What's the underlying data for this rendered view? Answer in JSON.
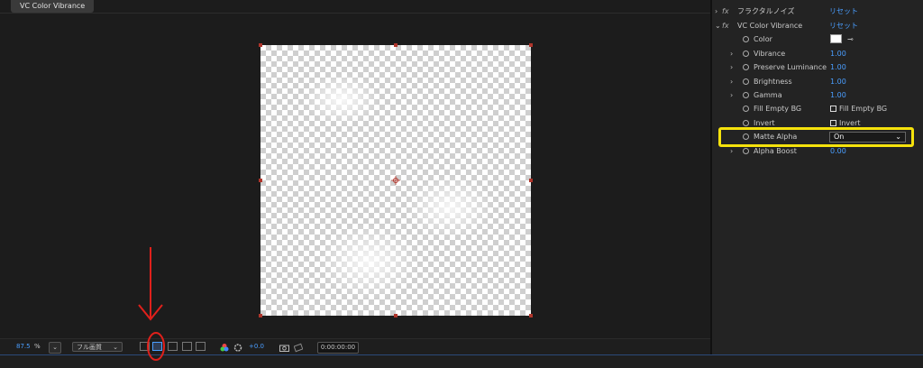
{
  "composition": {
    "tab_label": "VC Color Vibrance"
  },
  "viewer_bar": {
    "zoom_value": "87.5",
    "zoom_unit": "%",
    "zoom_chevron": "⌄",
    "resolution": "フル画質",
    "resolution_chevron": "⌄",
    "exposure": "+0.0",
    "timecode": "0:00:00:00"
  },
  "effects": {
    "fractal": {
      "name": "フラクタルノイズ",
      "reset": "リセット"
    },
    "vc": {
      "name": "VC Color Vibrance",
      "reset": "リセット"
    },
    "properties": {
      "color": {
        "label": "Color"
      },
      "vibrance": {
        "label": "Vibrance",
        "value": "1.00"
      },
      "preserve_luminance": {
        "label": "Preserve Luminance",
        "value": "1.00"
      },
      "brightness": {
        "label": "Brightness",
        "value": "1.00"
      },
      "gamma": {
        "label": "Gamma",
        "value": "1.00"
      },
      "fill_empty_bg": {
        "label": "Fill Empty BG",
        "checkbox_label": "Fill Empty BG"
      },
      "invert": {
        "label": "Invert",
        "checkbox_label": "Invert"
      },
      "matte_alpha": {
        "label": "Matte Alpha",
        "selected": "On"
      },
      "alpha_boost": {
        "label": "Alpha Boost",
        "value": "0.00"
      }
    }
  },
  "colors": {
    "accent_blue": "#4a9eff",
    "highlight_yellow": "#f5e20c",
    "annotation_red": "#e0201b",
    "handle_red": "#b0352b"
  }
}
